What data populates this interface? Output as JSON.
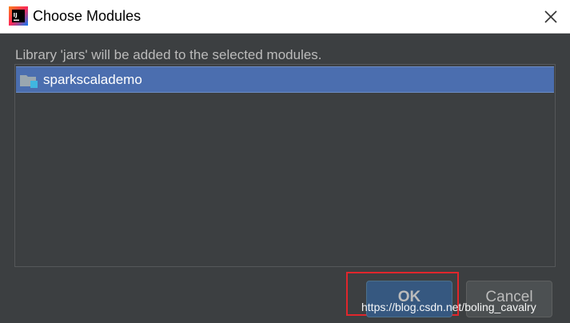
{
  "window": {
    "title": "Choose Modules",
    "app_icon": "intellij-idea-icon",
    "close_icon": "close-icon"
  },
  "dialog": {
    "message": "Library 'jars' will be added to the selected modules.",
    "modules": [
      {
        "label": "sparkscalademo",
        "icon": "module-folder-icon",
        "selected": true
      }
    ]
  },
  "buttons": {
    "ok_label": "OK",
    "cancel_label": "Cancel"
  },
  "watermark": "https://blog.csdn.net/boling_cavalry",
  "colors": {
    "background": "#3c3f41",
    "selection": "#4b6eaf",
    "ok_button": "#365880",
    "highlight_box": "#e0262c"
  }
}
